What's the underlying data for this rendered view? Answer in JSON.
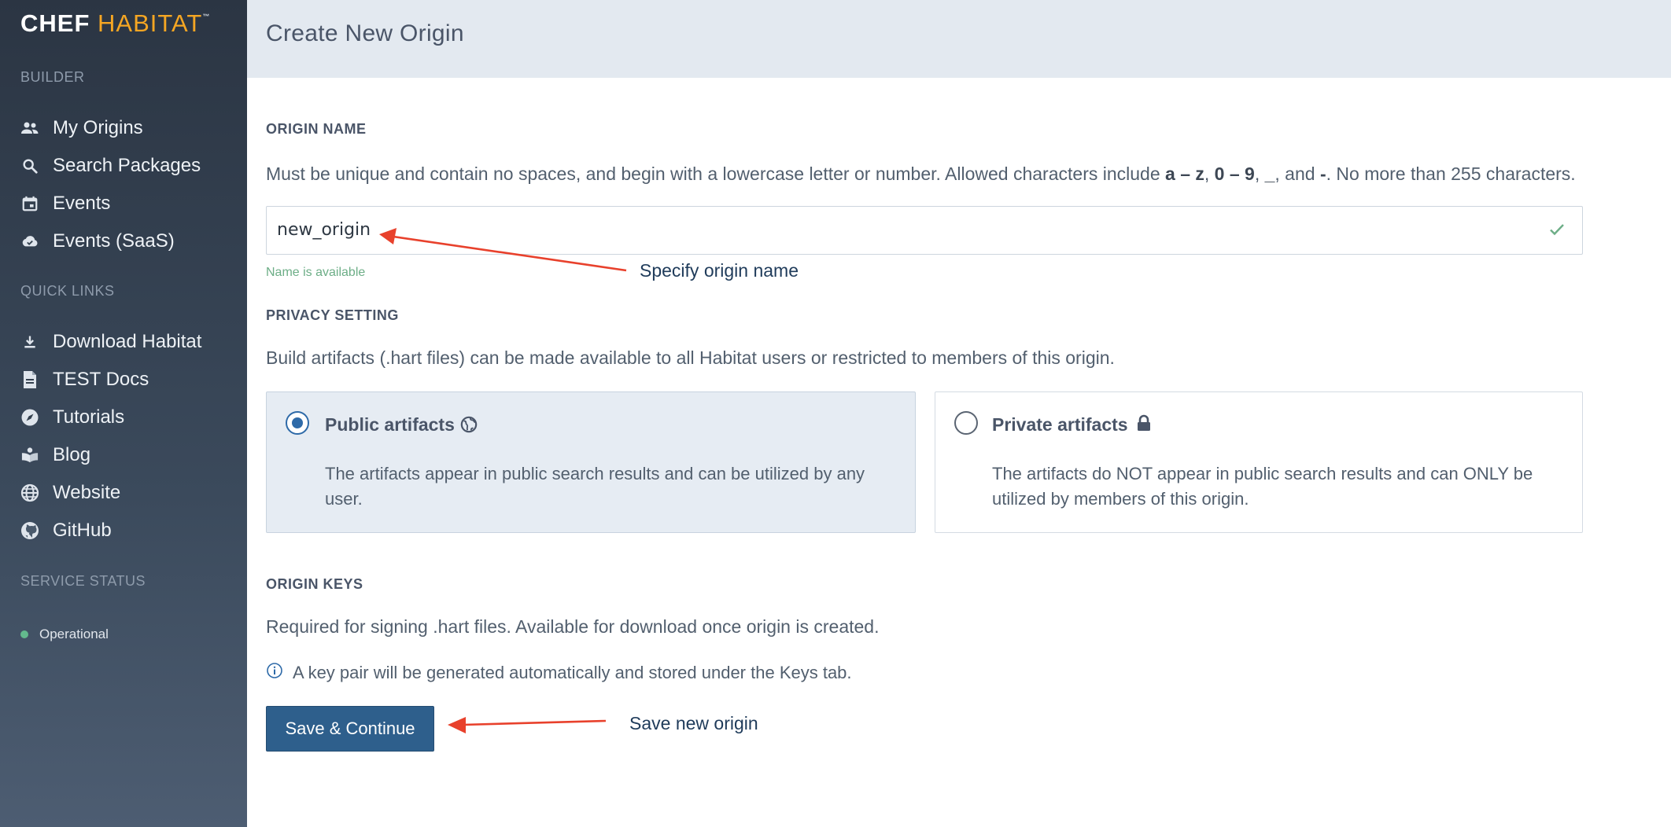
{
  "brand": {
    "chef": "CHEF",
    "habitat": "HABITAT",
    "tm": "™"
  },
  "sidebar": {
    "builder_heading": "BUILDER",
    "builder_items": [
      {
        "label": "My Origins",
        "icon": "people-icon"
      },
      {
        "label": "Search Packages",
        "icon": "search-icon"
      },
      {
        "label": "Events",
        "icon": "calendar-icon"
      },
      {
        "label": "Events (SaaS)",
        "icon": "cloud-check-icon"
      }
    ],
    "quick_links_heading": "QUICK LINKS",
    "quick_links": [
      {
        "label": "Download Habitat",
        "icon": "download-icon"
      },
      {
        "label": "TEST Docs",
        "icon": "document-icon"
      },
      {
        "label": "Tutorials",
        "icon": "compass-icon"
      },
      {
        "label": "Blog",
        "icon": "book-icon"
      },
      {
        "label": "Website",
        "icon": "globe-icon"
      },
      {
        "label": "GitHub",
        "icon": "github-icon"
      }
    ],
    "service_status_heading": "SERVICE STATUS",
    "status_label": "Operational",
    "status_color": "#63b98d"
  },
  "header": {
    "title": "Create New Origin"
  },
  "origin_name": {
    "label": "ORIGIN NAME",
    "help_prefix": "Must be unique and contain no spaces, and begin with a lowercase letter or number. Allowed characters include ",
    "help_az": "a – z",
    "help_sep1": ", ",
    "help_09": "0 – 9",
    "help_sep2": ", ",
    "help_underscore": "_",
    "help_sep3": ", and ",
    "help_dash": "-",
    "help_suffix": ". No more than 255 characters.",
    "value": "new_origin",
    "availability": "Name is available"
  },
  "privacy": {
    "label": "PRIVACY SETTING",
    "help": "Build artifacts (.hart files) can be made available to all Habitat users or restricted to members of this origin.",
    "public": {
      "title": "Public artifacts",
      "description": "The artifacts appear in public search results and can be utilized by any user.",
      "selected": true
    },
    "private": {
      "title": "Private artifacts",
      "description": "The artifacts do NOT appear in public search results and can ONLY be utilized by members of this origin.",
      "selected": false
    }
  },
  "origin_keys": {
    "label": "ORIGIN KEYS",
    "help": "Required for signing .hart files. Available for download once origin is created.",
    "info": "A key pair will be generated automatically and stored under the Keys tab."
  },
  "actions": {
    "save_label": "Save & Continue"
  },
  "annotations": {
    "name_note": "Specify origin name",
    "save_note": "Save new origin",
    "arrow_color": "#e8412c"
  },
  "colors": {
    "accent": "#2e5f8c",
    "brand_orange": "#f5a623",
    "success": "#6dae87"
  }
}
